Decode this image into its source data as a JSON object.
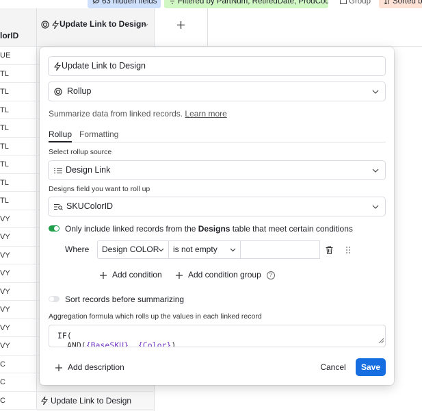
{
  "toolbar": {
    "hidden_fields": "63 hidden fields",
    "filtered": "Filtered by PartNum, RetiredDate, ProdCode",
    "group": "Group",
    "sorted": "Sorted b"
  },
  "grid": {
    "col_a_header": "lorID",
    "col_b_header": "Update Link to Design",
    "rows": [
      {
        "a": "UE",
        "b": ""
      },
      {
        "a": "TL",
        "b": ""
      },
      {
        "a": "TL",
        "b": ""
      },
      {
        "a": "TL",
        "b": ""
      },
      {
        "a": "TL",
        "b": ""
      },
      {
        "a": "TL",
        "b": ""
      },
      {
        "a": "TL",
        "b": ""
      },
      {
        "a": "TL",
        "b": ""
      },
      {
        "a": "TL",
        "b": ""
      },
      {
        "a": "VY",
        "b": ""
      },
      {
        "a": "VY",
        "b": ""
      },
      {
        "a": "VY",
        "b": ""
      },
      {
        "a": "VY",
        "b": ""
      },
      {
        "a": "VY",
        "b": ""
      },
      {
        "a": "VY",
        "b": ""
      },
      {
        "a": "VY",
        "b": ""
      },
      {
        "a": "VY",
        "b": ""
      },
      {
        "a": "C",
        "b": ""
      },
      {
        "a": "C",
        "b": ""
      },
      {
        "a": "C",
        "b": "Update Link to Design"
      }
    ]
  },
  "dialog": {
    "field_name": "Update Link to Design",
    "field_type": "Rollup",
    "description": "Summarize data from linked records.",
    "learn_more": "Learn more",
    "tabs": [
      "Rollup",
      "Formatting"
    ],
    "rollup_source_label": "Select rollup source",
    "rollup_source": "Design Link",
    "field_label": "Designs field you want to roll up",
    "field_value": "SKUColorID",
    "condition_toggle": {
      "pre": "Only include linked records from the ",
      "table": "Designs",
      "post": " table that meet certain conditions",
      "on": true
    },
    "condition": {
      "where": "Where",
      "field": "Design COLOR",
      "operator": "is not empty",
      "value": ""
    },
    "add_condition": "Add condition",
    "add_condition_group": "Add condition group",
    "sort_toggle": {
      "label": "Sort records before summarizing",
      "on": false
    },
    "aggregation_label": "Aggregation formula which rolls up the values in each linked record",
    "formula_line1": "IF(",
    "formula_line2_pre": "AND(",
    "formula_line2_tok1": "{BaseSKU}",
    "formula_line2_mid": ", ",
    "formula_line2_tok2": "{Color}",
    "formula_line2_post": ")",
    "add_description": "Add description",
    "cancel": "Cancel",
    "save": "Save"
  },
  "colors": {
    "save_bg": "#166ee1",
    "toggle_on": "#20a04a",
    "filter_chip": "#d1f7c4",
    "hidden_chip": "#cfe0fd",
    "sort_chip": "#fee2d5"
  }
}
